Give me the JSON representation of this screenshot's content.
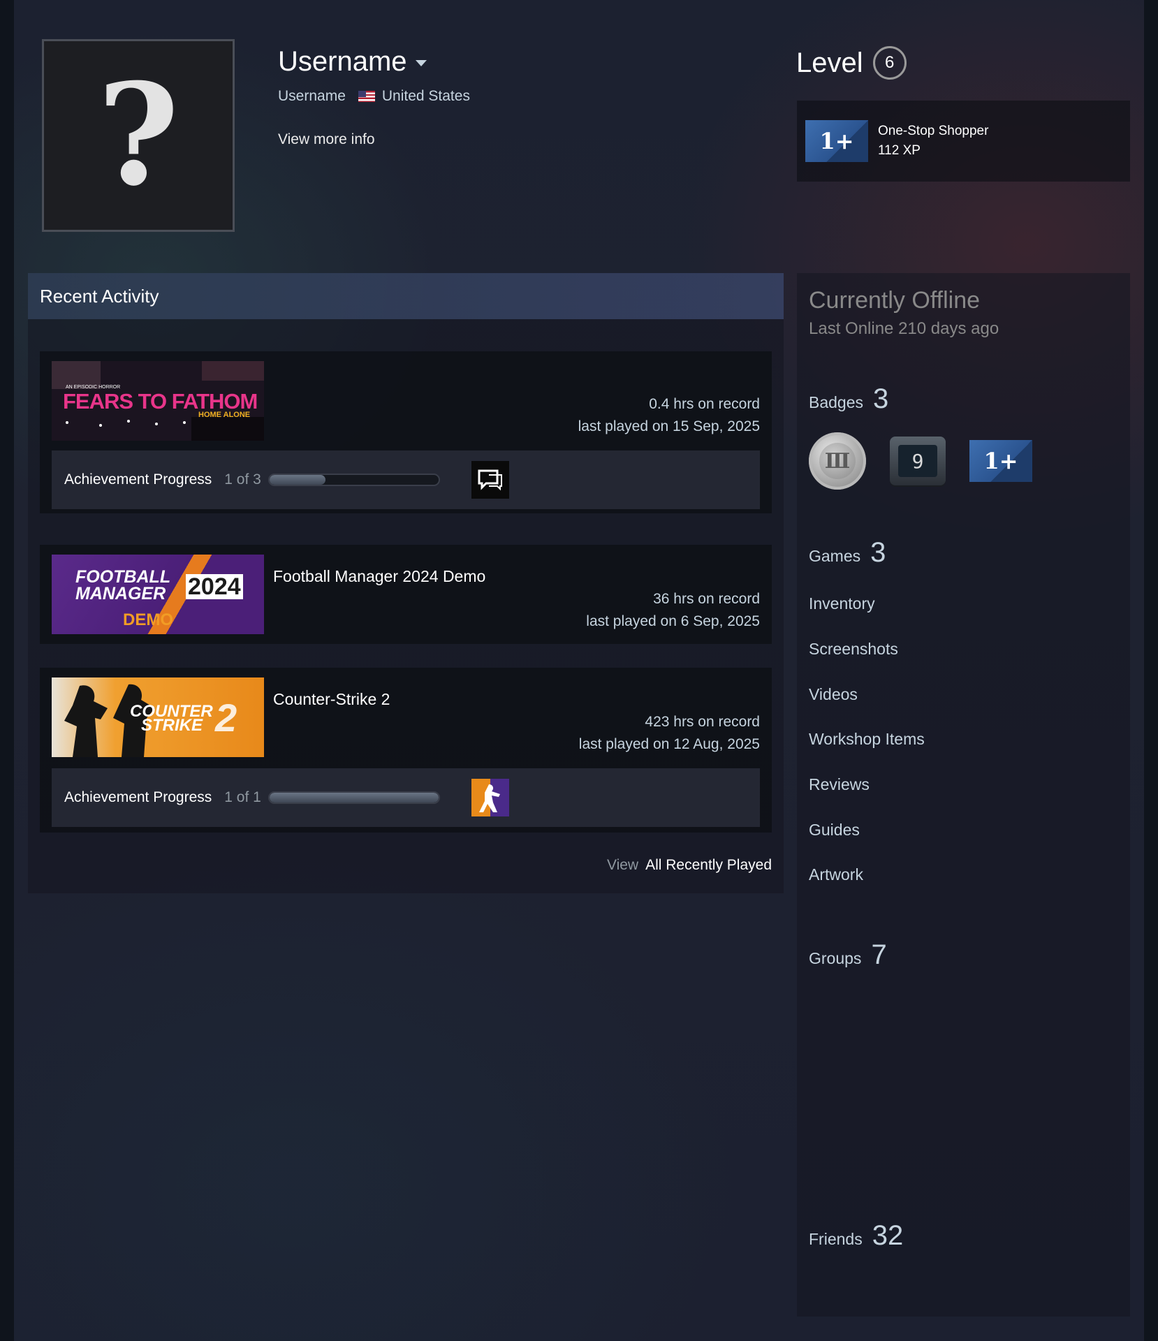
{
  "profile": {
    "avatar_glyph": "?",
    "persona_name": "Username",
    "real_name": "Username",
    "country": "United States",
    "view_more": "View more info"
  },
  "level": {
    "label": "Level",
    "value": "6"
  },
  "featured_badge": {
    "name": "One-Stop Shopper",
    "xp": "112 XP",
    "glyph": "1+"
  },
  "recent_activity": {
    "title": "Recent Activity",
    "games": [
      {
        "name": "",
        "capsule_text": "FEARS TO FATHOM",
        "capsule_sub": "HOME ALONE",
        "capsule_tag": "AN EPISODIC HORROR",
        "hours": "0.4 hrs on record",
        "last_played": "last played on 15 Sep, 2025",
        "achievement_label": "Achievement Progress",
        "achievement_count": "1 of 3",
        "achievement_progress": 0.333
      },
      {
        "name": "Football Manager 2024 Demo",
        "capsule_line1": "FOOTBALL",
        "capsule_line2": "MANAGER",
        "capsule_year": "2024",
        "capsule_demo": "DEMO",
        "hours": "36 hrs on record",
        "last_played": "last played on 6 Sep, 2025"
      },
      {
        "name": "Counter-Strike 2",
        "capsule_line1": "COUNTER",
        "capsule_line2": "STRIKE",
        "capsule_num": "2",
        "hours": "423 hrs on record",
        "last_played": "last played on 12 Aug, 2025",
        "achievement_label": "Achievement Progress",
        "achievement_count": "1 of 1",
        "achievement_progress": 1.0
      }
    ],
    "view_prefix": "View",
    "view_link": "All Recently Played"
  },
  "sidebar": {
    "status": "Currently Offline",
    "last_online": "Last Online 210 days ago",
    "badges_label": "Badges",
    "badges_count": "3",
    "badge_items": [
      "coin-badge",
      "years-badge",
      "one-plus-badge"
    ],
    "badge_nine": "9",
    "badge_oneplus": "1+",
    "games_label": "Games",
    "games_count": "3",
    "links": [
      "Inventory",
      "Screenshots",
      "Videos",
      "Workshop Items",
      "Reviews",
      "Guides",
      "Artwork"
    ],
    "groups_label": "Groups",
    "groups_count": "7",
    "friends_label": "Friends",
    "friends_count": "32"
  }
}
